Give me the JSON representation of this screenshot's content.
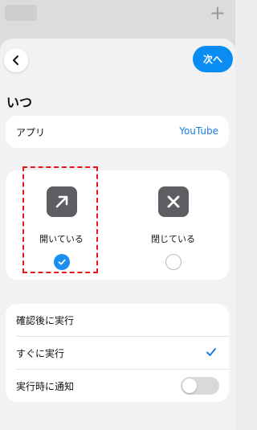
{
  "header": {
    "back_icon": "chevron-left-icon",
    "next_label": "次へ",
    "add_icon": "plus-icon"
  },
  "section": {
    "title": "いつ"
  },
  "app_row": {
    "label": "アプリ",
    "value": "YouTube"
  },
  "choices": [
    {
      "label": "開いている",
      "icon": "arrow-up-right-icon",
      "selected": true
    },
    {
      "label": "閉じている",
      "icon": "close-x-icon",
      "selected": false
    }
  ],
  "options": [
    {
      "label": "確認後に実行",
      "checked": false
    },
    {
      "label": "すぐに実行",
      "checked": true
    },
    {
      "label": "実行時に通知",
      "toggle_on": false
    }
  ],
  "colors": {
    "accent": "#0a8df2",
    "highlight": "#e41818"
  }
}
